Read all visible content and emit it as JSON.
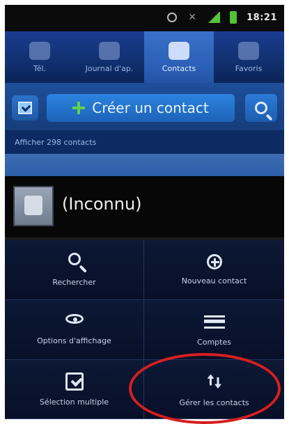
{
  "status_bar": {
    "time": "18:21"
  },
  "tabs": [
    {
      "label": "Tél.",
      "active": false,
      "icon": "phone-icon"
    },
    {
      "label": "Journal d'ap.",
      "active": false,
      "icon": "call-log-icon"
    },
    {
      "label": "Contacts",
      "active": true,
      "icon": "contacts-icon"
    },
    {
      "label": "Favoris",
      "active": false,
      "icon": "star-icon"
    }
  ],
  "actions": {
    "create_contact": "Créer un contact"
  },
  "contacts": {
    "count_label": "Afficher 298 contacts",
    "rows": [
      {
        "name": "(Inconnu)"
      }
    ]
  },
  "menu": {
    "items": [
      {
        "label": "Rechercher",
        "icon": "search-icon"
      },
      {
        "label": "Nouveau contact",
        "icon": "add-circle-icon"
      },
      {
        "label": "Options d'affichage",
        "icon": "eye-icon"
      },
      {
        "label": "Comptes",
        "icon": "accounts-icon"
      },
      {
        "label": "Sélection multiple",
        "icon": "multiselect-icon"
      },
      {
        "label": "Gérer les contacts",
        "icon": "manage-arrows-icon"
      }
    ]
  },
  "colors": {
    "highlight": "#d71f1f",
    "tab_active": "#2b5fb6"
  }
}
